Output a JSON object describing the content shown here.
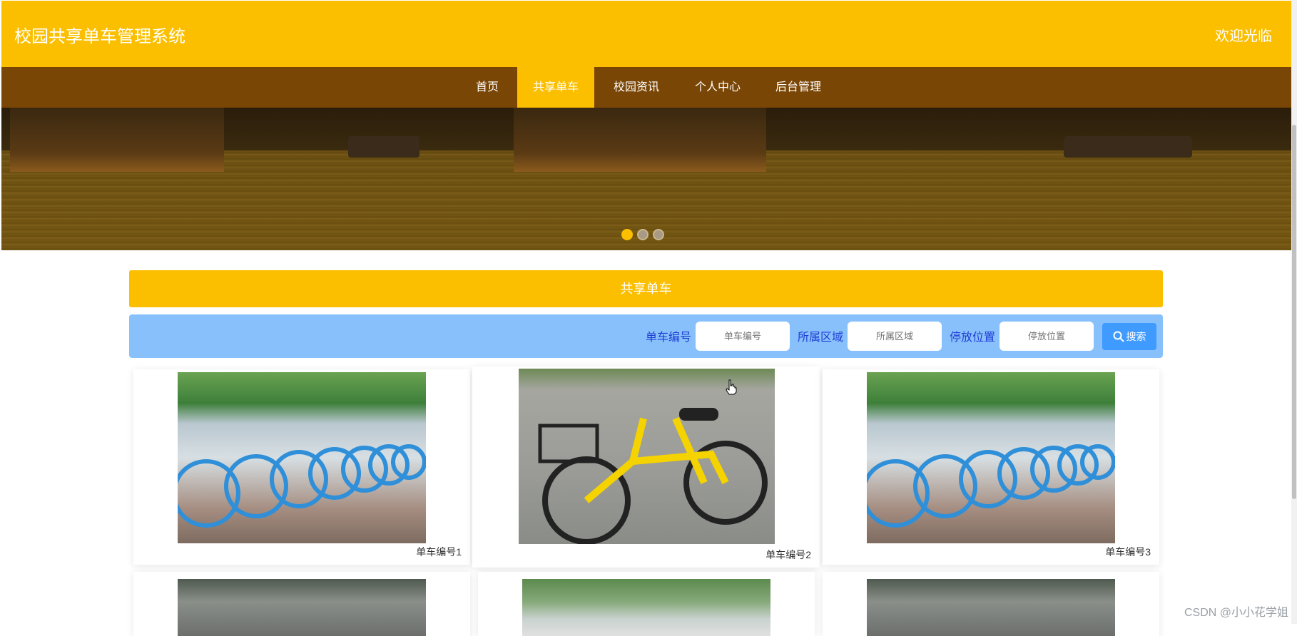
{
  "header": {
    "site_title": "校园共享单车管理系统",
    "welcome": "欢迎光临"
  },
  "nav": {
    "items": [
      {
        "label": "首页",
        "active": false
      },
      {
        "label": "共享单车",
        "active": true
      },
      {
        "label": "校园资讯",
        "active": false
      },
      {
        "label": "个人中心",
        "active": false
      },
      {
        "label": "后台管理",
        "active": false
      }
    ]
  },
  "banner": {
    "slide_count": 3,
    "active_slide": 1
  },
  "section": {
    "title": "共享单车"
  },
  "search": {
    "fields": [
      {
        "label": "单车编号",
        "placeholder": "单车编号"
      },
      {
        "label": "所属区域",
        "placeholder": "所属区域"
      },
      {
        "label": "停放位置",
        "placeholder": "停放位置"
      }
    ],
    "button_label": "搜索"
  },
  "bikes": [
    {
      "name": "单车编号1",
      "photo": "blue-bikes-row"
    },
    {
      "name": "单车编号2",
      "photo": "yellow-bike"
    },
    {
      "name": "单车编号3",
      "photo": "blue-bikes-row"
    }
  ],
  "colors": {
    "header_bg": "#FBBF00",
    "nav_bg": "#7A4606",
    "search_bg": "#87C0FB",
    "search_label": "#1F3DD6",
    "search_button": "#3F9BFF"
  },
  "watermark": "CSDN @小小花学姐"
}
